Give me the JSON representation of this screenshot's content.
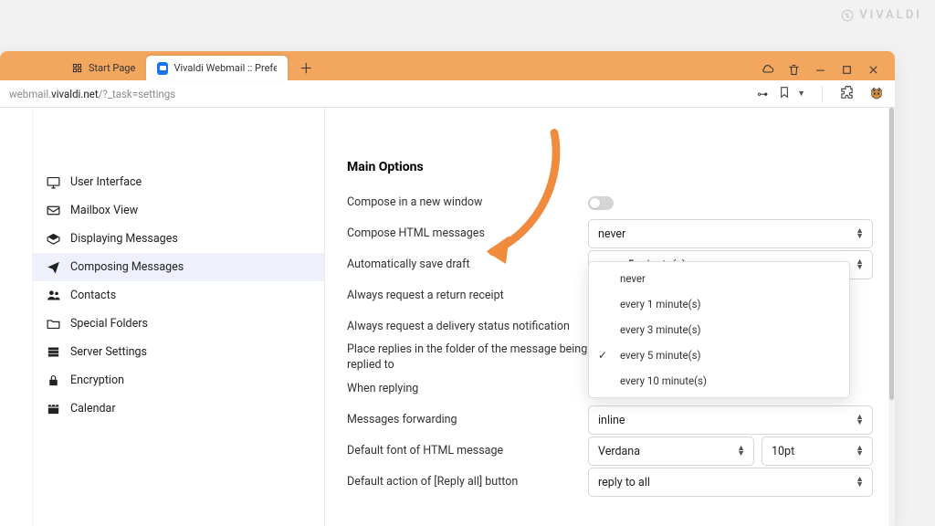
{
  "app_mark": "VIVALDI",
  "tabs": {
    "start": "Start Page",
    "webmail": "Vivaldi Webmail :: Preferen"
  },
  "url": {
    "prefix": "webmail.",
    "host": "vivaldi.net",
    "path": "/?_task=settings"
  },
  "sidebar": {
    "user_interface": "User Interface",
    "mailbox_view": "Mailbox View",
    "displaying": "Displaying Messages",
    "composing": "Composing Messages",
    "contacts": "Contacts",
    "special_folders": "Special Folders",
    "server_settings": "Server Settings",
    "encryption": "Encryption",
    "calendar": "Calendar"
  },
  "main": {
    "heading": "Main Options",
    "compose_new_window": "Compose in a new window",
    "compose_html": "Compose HTML messages",
    "compose_html_value": "never",
    "autosave": "Automatically save draft",
    "autosave_value": "every 5 minute(s)",
    "request_receipt": "Always request a return receipt",
    "request_dsn": "Always request a delivery status notification",
    "place_replies": "Place replies in the folder of the message being replied to",
    "when_replying": "When replying",
    "forwarding": "Messages forwarding",
    "forwarding_value": "inline",
    "default_font": "Default font of HTML message",
    "default_font_value": "Verdana",
    "default_font_size": "10pt",
    "reply_all": "Default action of [Reply all] button",
    "reply_all_value": "reply to all",
    "autosave_options": {
      "never": "never",
      "m1": "every 1 minute(s)",
      "m3": "every 3 minute(s)",
      "m5": "every 5 minute(s)",
      "m10": "every 10 minute(s)"
    }
  }
}
